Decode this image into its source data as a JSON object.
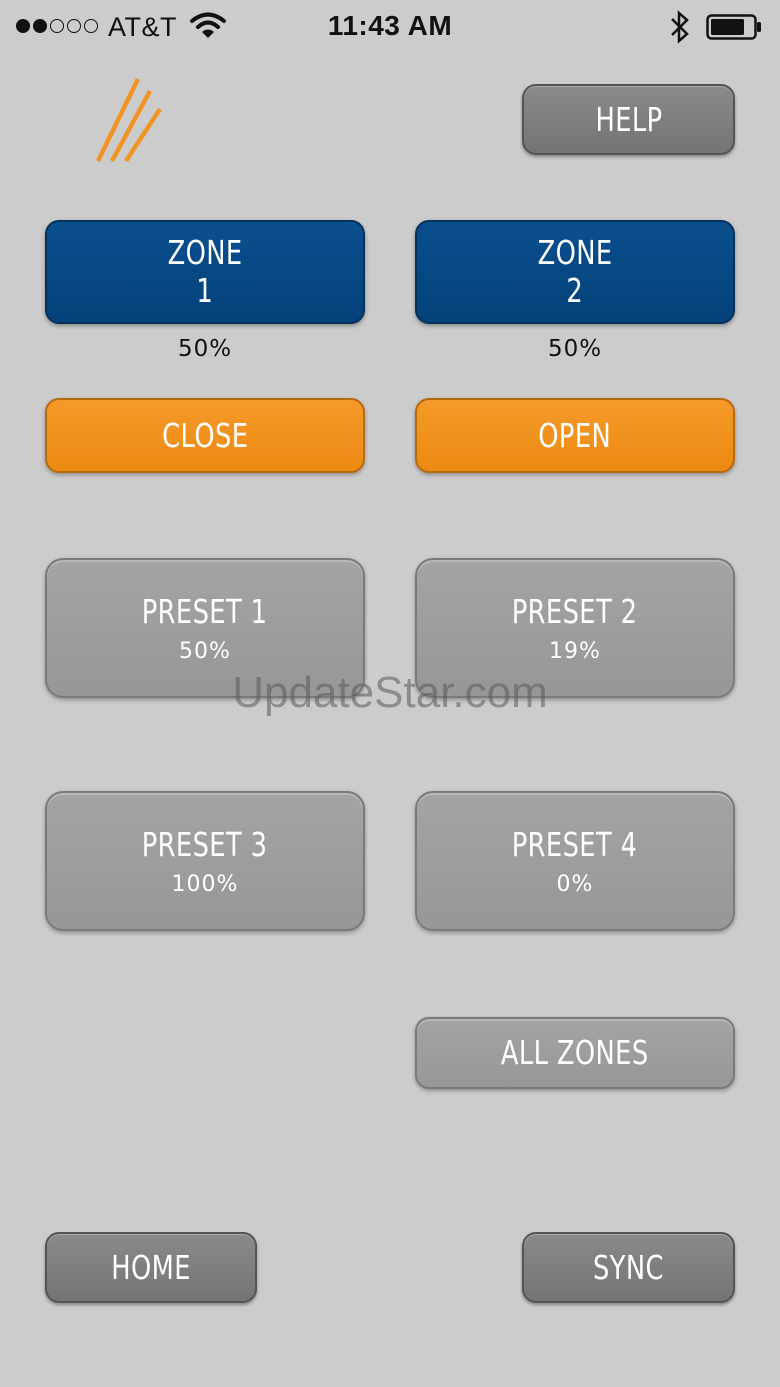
{
  "status_bar": {
    "carrier": "AT&T",
    "time": "11:43 AM",
    "signal_icon": "signal-dots-icon",
    "wifi_icon": "wifi-icon",
    "bluetooth_icon": "bluetooth-icon",
    "battery_icon": "battery-icon"
  },
  "logo": {
    "icon": "brand-stripes-logo",
    "color": "#f29424"
  },
  "header": {
    "help_label": "HELP"
  },
  "zones": [
    {
      "label_line1": "ZONE",
      "label_line2": "1",
      "percent": "50%"
    },
    {
      "label_line1": "ZONE",
      "label_line2": "2",
      "percent": "50%"
    }
  ],
  "actions": {
    "close_label": "CLOSE",
    "open_label": "OPEN"
  },
  "presets": [
    {
      "label": "PRESET 1",
      "value": "50%"
    },
    {
      "label": "PRESET 2",
      "value": "19%"
    },
    {
      "label": "PRESET 3",
      "value": "100%"
    },
    {
      "label": "PRESET 4",
      "value": "0%"
    }
  ],
  "all_zones_label": "ALL ZONES",
  "footer": {
    "home_label": "HOME",
    "sync_label": "SYNC"
  },
  "watermark": "UpdateStar.com",
  "colors": {
    "background": "#cccccc",
    "zone_blue": "#04427a",
    "action_orange": "#ec8a12",
    "preset_gray": "#979797",
    "nav_gray": "#747474"
  }
}
